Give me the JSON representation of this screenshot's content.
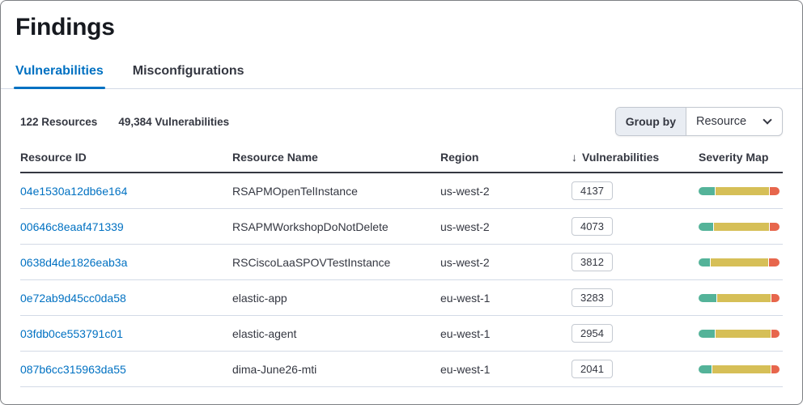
{
  "page": {
    "title": "Findings"
  },
  "tabs": [
    {
      "label": "Vulnerabilities",
      "active": true
    },
    {
      "label": "Misconfigurations",
      "active": false
    }
  ],
  "summary": {
    "resources": "122 Resources",
    "vulnerabilities": "49,384 Vulnerabilities"
  },
  "group_by": {
    "label": "Group by",
    "value": "Resource",
    "chevron_icon": "chevron-down-icon"
  },
  "table": {
    "columns": [
      "Resource ID",
      "Resource Name",
      "Region",
      "Vulnerabilities",
      "Severity Map"
    ],
    "sort": {
      "column": "Vulnerabilities",
      "direction": "desc",
      "icon": "arrow-down-icon",
      "glyph": "↓"
    },
    "rows": [
      {
        "resource_id": "04e1530a12db6e164",
        "resource_name": "RSAPMOpenTelInstance",
        "region": "us-west-2",
        "vulnerabilities": "4137",
        "severity": [
          {
            "level": "low",
            "pct": 20
          },
          {
            "level": "medium",
            "pct": 68
          },
          {
            "level": "critical",
            "pct": 12
          }
        ]
      },
      {
        "resource_id": "00646c8eaaf471339",
        "resource_name": "RSAPMWorkshopDoNotDelete",
        "region": "us-west-2",
        "vulnerabilities": "4073",
        "severity": [
          {
            "level": "low",
            "pct": 18
          },
          {
            "level": "medium",
            "pct": 70
          },
          {
            "level": "critical",
            "pct": 12
          }
        ]
      },
      {
        "resource_id": "0638d4de1826eab3a",
        "resource_name": "RSCiscoLaaSPOVTestInstance",
        "region": "us-west-2",
        "vulnerabilities": "3812",
        "severity": [
          {
            "level": "low",
            "pct": 14
          },
          {
            "level": "medium",
            "pct": 73
          },
          {
            "level": "critical",
            "pct": 13
          }
        ]
      },
      {
        "resource_id": "0e72ab9d45cc0da58",
        "resource_name": "elastic-app",
        "region": "eu-west-1",
        "vulnerabilities": "3283",
        "severity": [
          {
            "level": "low",
            "pct": 22
          },
          {
            "level": "medium",
            "pct": 68
          },
          {
            "level": "critical",
            "pct": 10
          }
        ]
      },
      {
        "resource_id": "03fdb0ce553791c01",
        "resource_name": "elastic-agent",
        "region": "eu-west-1",
        "vulnerabilities": "2954",
        "severity": [
          {
            "level": "low",
            "pct": 20
          },
          {
            "level": "medium",
            "pct": 70
          },
          {
            "level": "critical",
            "pct": 10
          }
        ]
      },
      {
        "resource_id": "087b6cc315963da55",
        "resource_name": "dima-June26-mti",
        "region": "eu-west-1",
        "vulnerabilities": "2041",
        "severity": [
          {
            "level": "low",
            "pct": 16
          },
          {
            "level": "medium",
            "pct": 74
          },
          {
            "level": "critical",
            "pct": 10
          }
        ]
      }
    ]
  },
  "colors": {
    "link": "#0071c2",
    "tab_active": "#0071c2",
    "severity_low": "#54b399",
    "severity_medium": "#d6bf57",
    "severity_critical": "#e7664c"
  }
}
